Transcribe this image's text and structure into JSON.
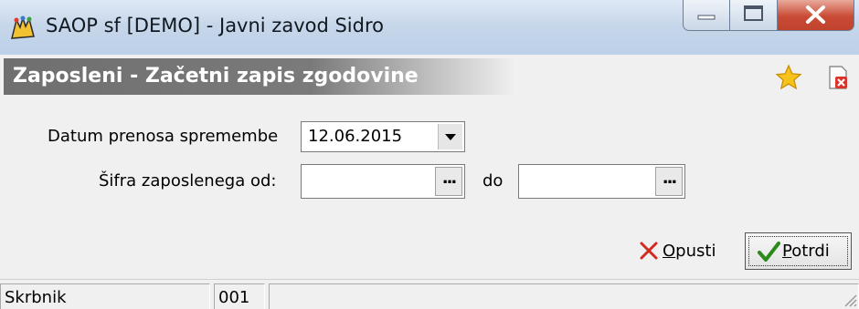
{
  "window": {
    "title": "SAOP sf [DEMO] - Javni zavod Sidro",
    "app_icon": "saop-app-icon"
  },
  "header": {
    "title": "Zaposleni - Začetni zapis zgodovine",
    "icons": [
      "star-icon",
      "close-document-icon"
    ]
  },
  "form": {
    "date_label": "Datum prenosa spremembe",
    "date_value": "12.06.2015",
    "code_from_label": "Šifra zaposlenega od:",
    "code_from_value": "",
    "code_to_label": "do",
    "code_to_value": "",
    "lookup_label": "..."
  },
  "buttons": {
    "cancel": {
      "mnemonic": "O",
      "rest": "pusti"
    },
    "confirm": {
      "mnemonic": "P",
      "rest": "otrdi"
    }
  },
  "status": {
    "user": "Skrbnik",
    "code": "001",
    "info": ""
  },
  "colors": {
    "title_gradient": "#c7d7ea",
    "header_band": "#777777",
    "close_button": "#c94b35",
    "confirm_check": "#2b8a1a",
    "cancel_x": "#d12a1f"
  }
}
